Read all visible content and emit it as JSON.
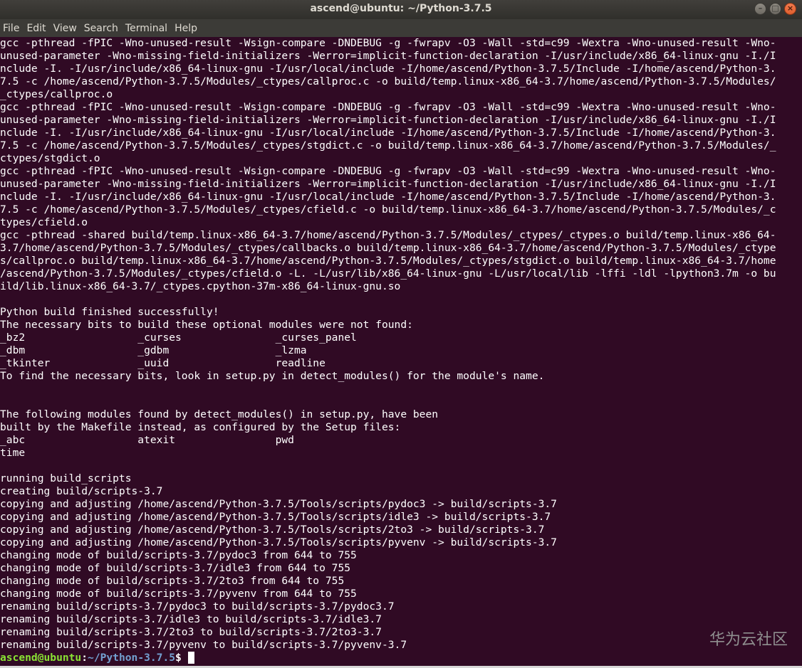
{
  "window": {
    "title": "ascend@ubuntu: ~/Python-3.7.5",
    "buttons": {
      "minimize": "–",
      "maximize": "□",
      "close": "×"
    }
  },
  "menu": [
    "File",
    "Edit",
    "View",
    "Search",
    "Terminal",
    "Help"
  ],
  "terminal": {
    "lines": [
      "gcc -pthread -fPIC -Wno-unused-result -Wsign-compare -DNDEBUG -g -fwrapv -O3 -Wall -std=c99 -Wextra -Wno-unused-result -Wno-",
      "unused-parameter -Wno-missing-field-initializers -Werror=implicit-function-declaration -I/usr/include/x86_64-linux-gnu -I./I",
      "nclude -I. -I/usr/include/x86_64-linux-gnu -I/usr/local/include -I/home/ascend/Python-3.7.5/Include -I/home/ascend/Python-3.",
      "7.5 -c /home/ascend/Python-3.7.5/Modules/_ctypes/callproc.c -o build/temp.linux-x86_64-3.7/home/ascend/Python-3.7.5/Modules/",
      "_ctypes/callproc.o",
      "gcc -pthread -fPIC -Wno-unused-result -Wsign-compare -DNDEBUG -g -fwrapv -O3 -Wall -std=c99 -Wextra -Wno-unused-result -Wno-",
      "unused-parameter -Wno-missing-field-initializers -Werror=implicit-function-declaration -I/usr/include/x86_64-linux-gnu -I./I",
      "nclude -I. -I/usr/include/x86_64-linux-gnu -I/usr/local/include -I/home/ascend/Python-3.7.5/Include -I/home/ascend/Python-3.",
      "7.5 -c /home/ascend/Python-3.7.5/Modules/_ctypes/stgdict.c -o build/temp.linux-x86_64-3.7/home/ascend/Python-3.7.5/Modules/_",
      "ctypes/stgdict.o",
      "gcc -pthread -fPIC -Wno-unused-result -Wsign-compare -DNDEBUG -g -fwrapv -O3 -Wall -std=c99 -Wextra -Wno-unused-result -Wno-",
      "unused-parameter -Wno-missing-field-initializers -Werror=implicit-function-declaration -I/usr/include/x86_64-linux-gnu -I./I",
      "nclude -I. -I/usr/include/x86_64-linux-gnu -I/usr/local/include -I/home/ascend/Python-3.7.5/Include -I/home/ascend/Python-3.",
      "7.5 -c /home/ascend/Python-3.7.5/Modules/_ctypes/cfield.c -o build/temp.linux-x86_64-3.7/home/ascend/Python-3.7.5/Modules/_c",
      "types/cfield.o",
      "gcc -pthread -shared build/temp.linux-x86_64-3.7/home/ascend/Python-3.7.5/Modules/_ctypes/_ctypes.o build/temp.linux-x86_64-",
      "3.7/home/ascend/Python-3.7.5/Modules/_ctypes/callbacks.o build/temp.linux-x86_64-3.7/home/ascend/Python-3.7.5/Modules/_ctype",
      "s/callproc.o build/temp.linux-x86_64-3.7/home/ascend/Python-3.7.5/Modules/_ctypes/stgdict.o build/temp.linux-x86_64-3.7/home",
      "/ascend/Python-3.7.5/Modules/_ctypes/cfield.o -L. -L/usr/lib/x86_64-linux-gnu -L/usr/local/lib -lffi -ldl -lpython3.7m -o bu",
      "ild/lib.linux-x86_64-3.7/_ctypes.cpython-37m-x86_64-linux-gnu.so",
      "",
      "Python build finished successfully!",
      "The necessary bits to build these optional modules were not found:",
      "_bz2                  _curses               _curses_panel",
      "_dbm                  _gdbm                 _lzma",
      "_tkinter              _uuid                 readline",
      "To find the necessary bits, look in setup.py in detect_modules() for the module's name.",
      "",
      "",
      "The following modules found by detect_modules() in setup.py, have been",
      "built by the Makefile instead, as configured by the Setup files:",
      "_abc                  atexit                pwd",
      "time",
      "",
      "running build_scripts",
      "creating build/scripts-3.7",
      "copying and adjusting /home/ascend/Python-3.7.5/Tools/scripts/pydoc3 -> build/scripts-3.7",
      "copying and adjusting /home/ascend/Python-3.7.5/Tools/scripts/idle3 -> build/scripts-3.7",
      "copying and adjusting /home/ascend/Python-3.7.5/Tools/scripts/2to3 -> build/scripts-3.7",
      "copying and adjusting /home/ascend/Python-3.7.5/Tools/scripts/pyvenv -> build/scripts-3.7",
      "changing mode of build/scripts-3.7/pydoc3 from 644 to 755",
      "changing mode of build/scripts-3.7/idle3 from 644 to 755",
      "changing mode of build/scripts-3.7/2to3 from 644 to 755",
      "changing mode of build/scripts-3.7/pyvenv from 644 to 755",
      "renaming build/scripts-3.7/pydoc3 to build/scripts-3.7/pydoc3.7",
      "renaming build/scripts-3.7/idle3 to build/scripts-3.7/idle3.7",
      "renaming build/scripts-3.7/2to3 to build/scripts-3.7/2to3-3.7",
      "renaming build/scripts-3.7/pyvenv to build/scripts-3.7/pyvenv-3.7"
    ],
    "prompt": {
      "user_host": "ascend@ubuntu",
      "separator": ":",
      "path": "~/Python-3.7.5",
      "symbol": "$ "
    }
  },
  "watermark": "华为云社区",
  "colors": {
    "background": "#300a24",
    "text": "#ffffff",
    "prompt_user": "#8ae234",
    "prompt_path": "#729fcf",
    "menubar": "#3c3b37"
  }
}
